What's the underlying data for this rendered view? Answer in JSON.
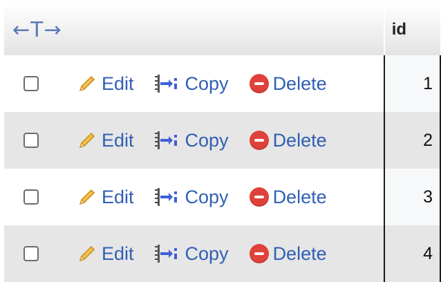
{
  "header": {
    "arrows_label": "←T→",
    "id_label": "id"
  },
  "actions": {
    "edit_label": "Edit",
    "copy_label": "Copy",
    "delete_label": "Delete"
  },
  "rows": [
    {
      "id": "1"
    },
    {
      "id": "2"
    },
    {
      "id": "3"
    },
    {
      "id": "4"
    }
  ],
  "icons": {
    "edit": "pencil-icon",
    "copy": "copy-insert-icon",
    "delete": "delete-circle-icon"
  },
  "colors": {
    "link": "#2f5fb3",
    "delete": "#e0413a",
    "arrows": "#5a78b8",
    "row_even": "#e6e6e6"
  }
}
